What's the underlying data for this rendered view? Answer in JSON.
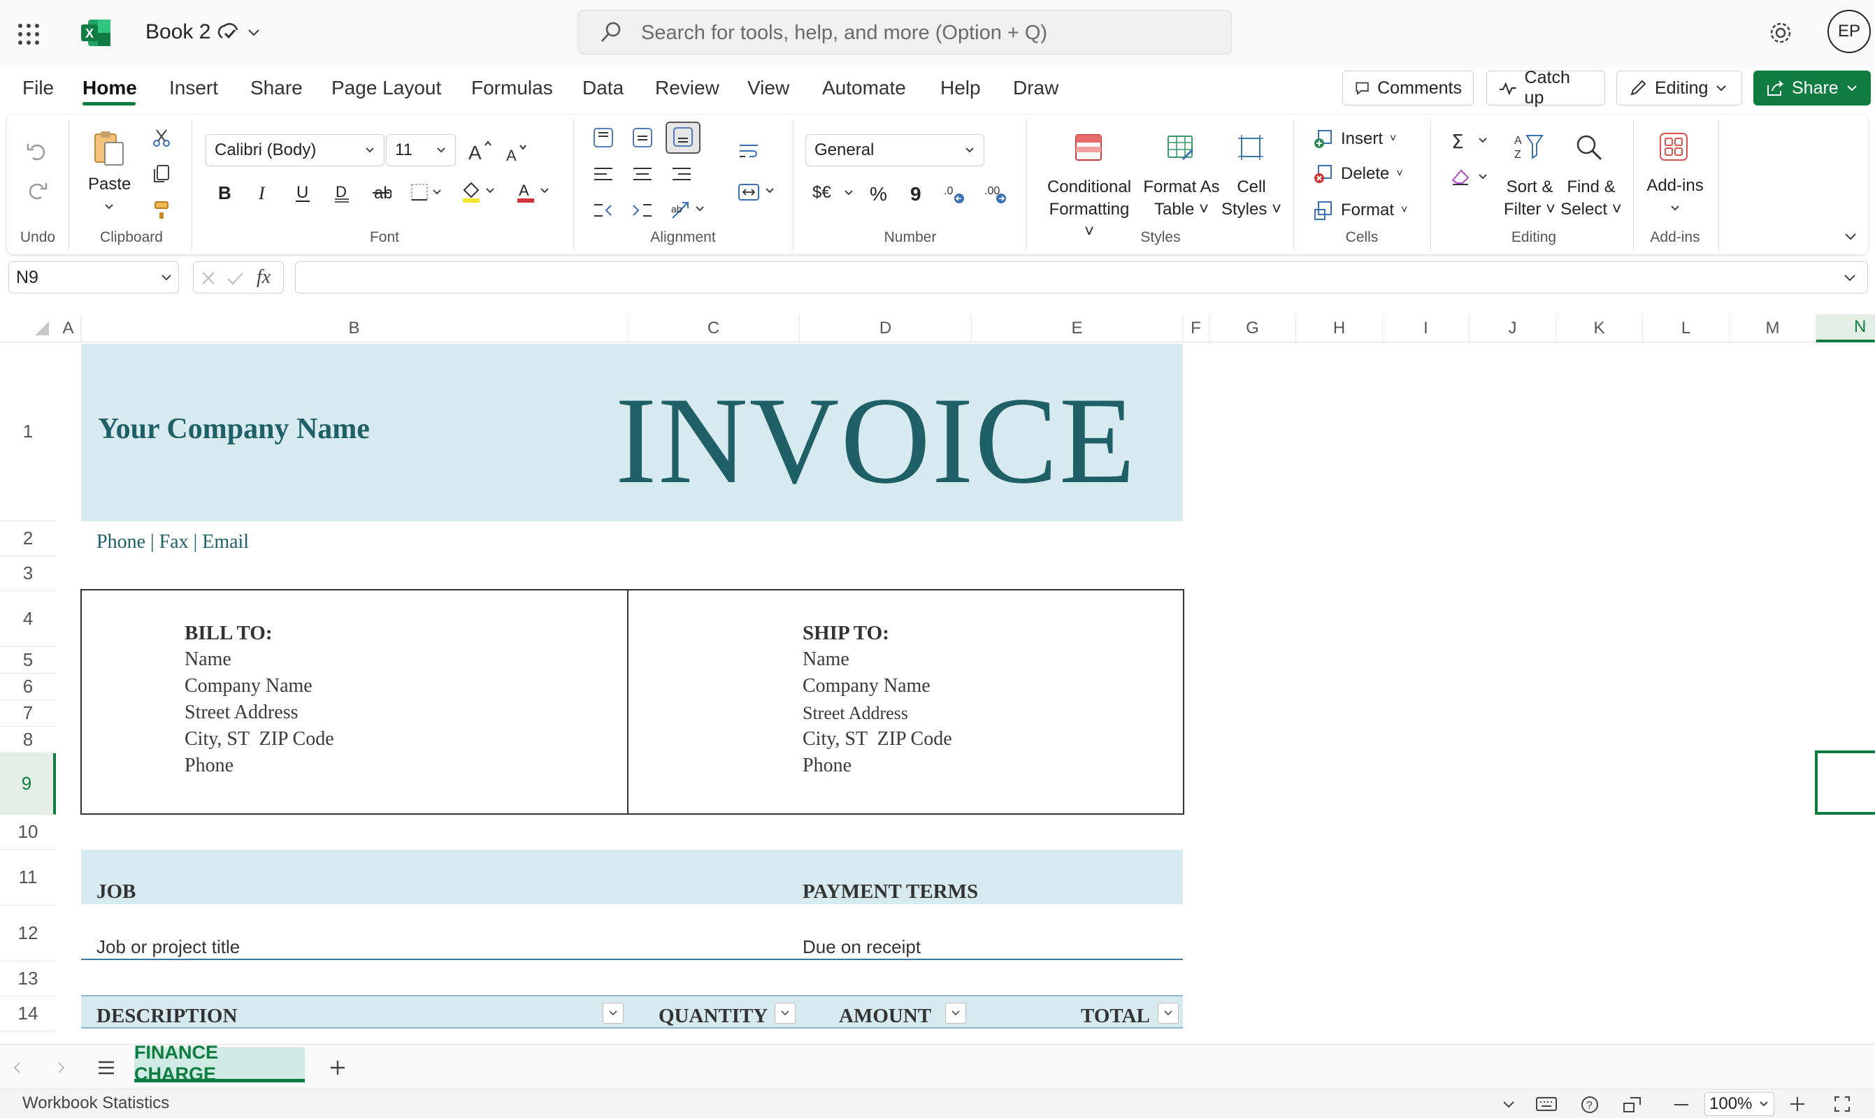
{
  "titlebar": {
    "workbook_name": "Book 2",
    "search_placeholder": "Search for tools, help, and more (Option + Q)",
    "avatar_initials": "EP"
  },
  "menu": {
    "items": [
      "File",
      "Home",
      "Insert",
      "Share",
      "Page Layout",
      "Formulas",
      "Data",
      "Review",
      "View",
      "Automate",
      "Help",
      "Draw"
    ],
    "active": "Home",
    "comments": "Comments",
    "catch_up": "Catch up",
    "editing": "Editing",
    "share": "Share"
  },
  "ribbon": {
    "undo_label": "Undo",
    "paste_label": "Paste",
    "clipboard_label": "Clipboard",
    "font_name": "Calibri (Body)",
    "font_size": "11",
    "font_label": "Font",
    "alignment_label": "Alignment",
    "number_format": "General",
    "number_label": "Number",
    "conditional": [
      "Conditional",
      "Formatting"
    ],
    "format_as": [
      "Format As",
      "Table"
    ],
    "cell_styles": [
      "Cell",
      "Styles"
    ],
    "styles_label": "Styles",
    "insert": "Insert",
    "delete": "Delete",
    "format": "Format",
    "cells_label": "Cells",
    "sort": [
      "Sort &",
      "Filter"
    ],
    "find": [
      "Find &",
      "Select"
    ],
    "editing_label": "Editing",
    "addins": "Add-ins",
    "addins_label": "Add-ins",
    "currency_symbol": "$€",
    "percent_symbol": "%",
    "comma_symbol": "9"
  },
  "formula_bar": {
    "name_box": "N9",
    "fx": "fx",
    "content": ""
  },
  "columns": [
    "A",
    "B",
    "C",
    "D",
    "E",
    "F",
    "G",
    "H",
    "I",
    "J",
    "K",
    "L",
    "M",
    "N"
  ],
  "rows": [
    "1",
    "2",
    "3",
    "4",
    "5",
    "6",
    "7",
    "8",
    "9",
    "10",
    "11",
    "12",
    "13",
    "14"
  ],
  "invoice": {
    "company_name": "Your Company Name",
    "title": "INVOICE",
    "contact": "Phone | Fax | Email",
    "bill_to": {
      "heading": "BILL TO:",
      "lines": [
        "Name",
        "Company Name",
        "Street Address",
        "City, ST  ZIP Code",
        "Phone"
      ]
    },
    "ship_to": {
      "heading": "SHIP TO:",
      "lines": [
        "Name",
        "Company Name",
        "Street Address",
        "City, ST  ZIP Code",
        "Phone"
      ]
    },
    "job_heading": "JOB",
    "job_value": "Job or project title",
    "terms_heading": "PAYMENT TERMS",
    "terms_value": "Due on receipt",
    "table_headers": [
      "DESCRIPTION",
      "QUANTITY",
      "AMOUNT",
      "TOTAL"
    ]
  },
  "sheet_tab": "FINANCE CHARGE",
  "status": {
    "left": "Workbook Statistics",
    "zoom": "100%"
  },
  "colors": {
    "accent_green": "#107c41",
    "teal_text": "#1f5f66",
    "teal_fill": "#d6eaf0"
  }
}
